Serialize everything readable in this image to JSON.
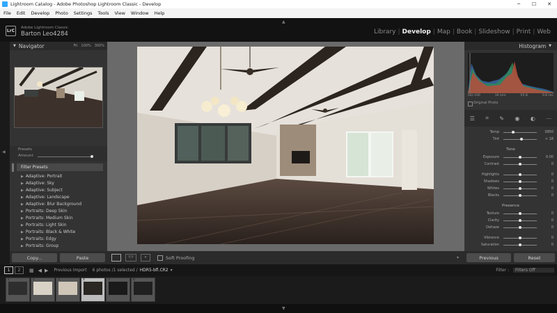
{
  "window": {
    "title": "Lightroom Catalog - Adobe Photoshop Lightroom Classic - Develop"
  },
  "menu": [
    "File",
    "Edit",
    "Develop",
    "Photo",
    "Settings",
    "Tools",
    "View",
    "Window",
    "Help"
  ],
  "identity": {
    "product": "Adobe Lightroom Classic",
    "user": "Barton Leo4284",
    "logo": "LrC"
  },
  "modules": [
    "Library",
    "Develop",
    "Map",
    "Book",
    "Slideshow",
    "Print",
    "Web"
  ],
  "active_module": "Develop",
  "navigator": {
    "title": "Navigator",
    "zoom_options": [
      "Fit",
      "100%",
      "300%"
    ]
  },
  "presets": {
    "header": "Presets",
    "amount_label": "Amount",
    "amount": 1.0,
    "filter_label": "Filter Presets",
    "items": [
      "Adaptive: Portrait",
      "Adaptive: Sky",
      "Adaptive: Subject",
      "Adaptive: Landscape",
      "Adaptive: Blur Background",
      "Portraits: Deep Skin",
      "Portraits: Medium Skin",
      "Portraits: Light Skin",
      "Portraits: Black & White",
      "Portraits: Edgy",
      "Portraits: Group"
    ]
  },
  "left_buttons": {
    "copy": "Copy...",
    "paste": "Paste"
  },
  "toolbar": {
    "soft_proofing": "Soft Proofing"
  },
  "histogram": {
    "title": "Histogram",
    "info": [
      "ISO 100",
      "16 mm",
      "f/2.8",
      "0.8 sec"
    ],
    "original_photo": "Original Photo"
  },
  "basic": {
    "wb": [
      {
        "label": "Temp",
        "value": "3850",
        "pos": 0.3
      },
      {
        "label": "Tint",
        "value": "+ 18",
        "pos": 0.55
      }
    ],
    "tone_header": "Tone",
    "tone": [
      {
        "label": "Exposure",
        "value": "0.00",
        "pos": 0.5
      },
      {
        "label": "Contrast",
        "value": "0",
        "pos": 0.5
      }
    ],
    "tone2": [
      {
        "label": "Highlights",
        "value": "0",
        "pos": 0.5
      },
      {
        "label": "Shadows",
        "value": "0",
        "pos": 0.5
      },
      {
        "label": "Whites",
        "value": "0",
        "pos": 0.5
      },
      {
        "label": "Blacks",
        "value": "0",
        "pos": 0.5
      }
    ],
    "presence_header": "Presence",
    "presence": [
      {
        "label": "Texture",
        "value": "0",
        "pos": 0.5
      },
      {
        "label": "Clarity",
        "value": "0",
        "pos": 0.5
      },
      {
        "label": "Dehaze",
        "value": "0",
        "pos": 0.5
      }
    ],
    "presence2": [
      {
        "label": "Vibrance",
        "value": "0",
        "pos": 0.5
      },
      {
        "label": "Saturation",
        "value": "0",
        "pos": 0.5
      }
    ]
  },
  "right_buttons": {
    "previous": "Previous",
    "reset": "Reset"
  },
  "filmstrip": {
    "pages": [
      "1",
      "2"
    ],
    "source": "Previous Import",
    "count": "6 photos /1 selected /",
    "filename": "HDR5-bfl.CR2",
    "filter_label": "Filter :",
    "filter_value": "Filters Off",
    "thumbs": [
      {
        "num": "1",
        "selected": false
      },
      {
        "num": "2",
        "selected": false
      },
      {
        "num": "3",
        "selected": false
      },
      {
        "num": "4",
        "selected": true
      },
      {
        "num": "5",
        "selected": false
      },
      {
        "num": "6",
        "selected": false
      }
    ]
  },
  "colors": {
    "panel": "#333333",
    "background": "#6a6a6a",
    "accent": "#ffffff"
  }
}
